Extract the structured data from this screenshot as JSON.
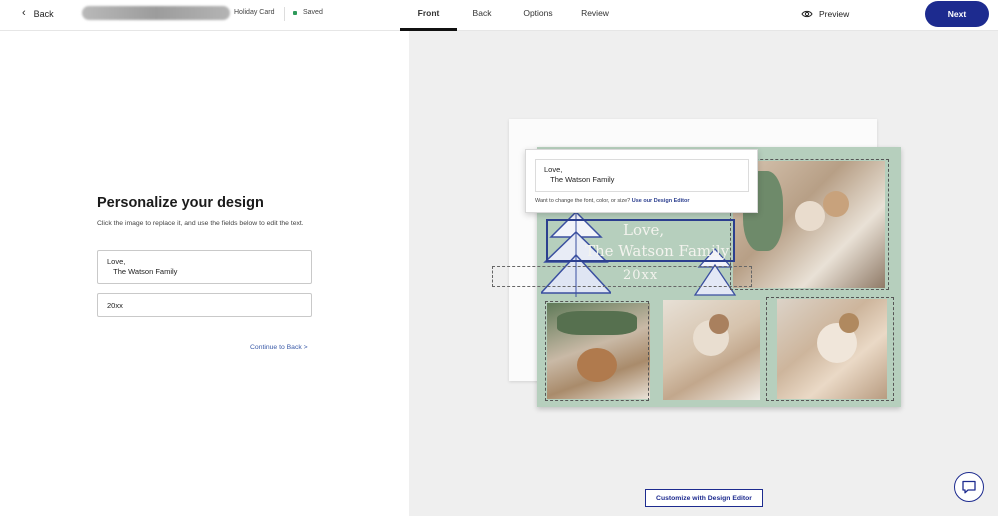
{
  "header": {
    "back_label": "Back",
    "product_name": "Holiday Card",
    "saved_label": "Saved",
    "tabs": [
      {
        "label": "Front",
        "active": true
      },
      {
        "label": "Back",
        "active": false
      },
      {
        "label": "Options",
        "active": false
      },
      {
        "label": "Review",
        "active": false
      }
    ],
    "preview_label": "Preview",
    "next_label": "Next"
  },
  "left": {
    "title": "Personalize your design",
    "subtitle": "Click the image to replace it, and use the fields below to edit the text.",
    "field1_value": "Love,\n   The Watson Family",
    "field2_value": "20xx",
    "continue_label": "Continue to Back >"
  },
  "card": {
    "line1": "Love,",
    "line2": "The Watson Family",
    "line3": "20xx"
  },
  "popup": {
    "field_value": "Love,\n   The Watson Family",
    "hint_text": "Want to change the font, color, or size? ",
    "hint_link": "Use our Design Editor"
  },
  "actions": {
    "customize_label": "Customize with Design Editor"
  },
  "colors": {
    "accent": "#1d2b8f",
    "card_bg": "#b6cfbd",
    "saved_dot": "#2e9a5a"
  },
  "icons": [
    "chevron-left-icon",
    "eye-icon",
    "chat-icon"
  ]
}
